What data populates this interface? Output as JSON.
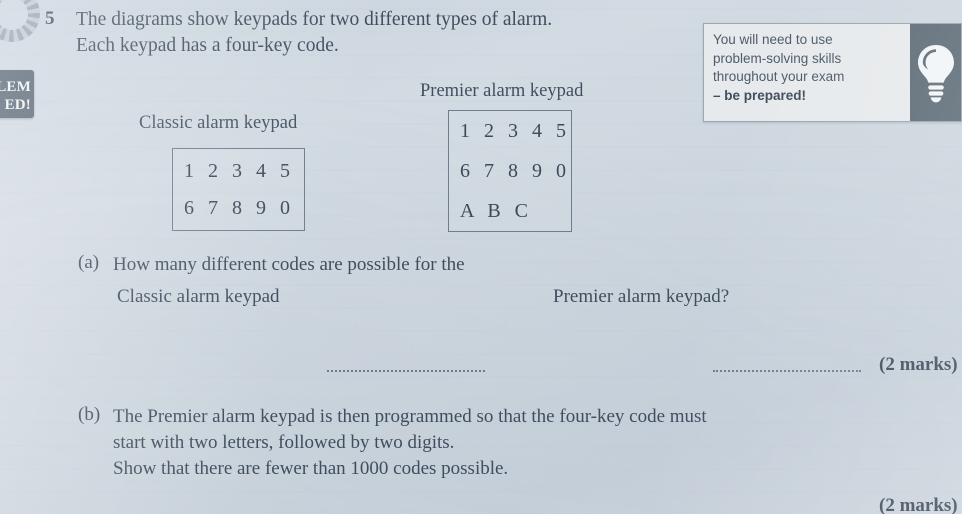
{
  "branding": {
    "logo_icon": "segmented-circle-logo",
    "badge": {
      "line1": "LEM",
      "line2": "ED!"
    }
  },
  "tip_box": {
    "line1": "You will need to use",
    "line2": "problem-solving skills",
    "line3": "throughout your exam",
    "line4": "– be prepared!",
    "icon": "lightbulb-icon",
    "background": "#e7eaec",
    "icon_panel_color": "#5f6d78"
  },
  "question": {
    "number": "5",
    "stem_line1": "The diagrams show keypads for two different types of alarm.",
    "stem_line2": "Each keypad has a four-key code."
  },
  "keypads": {
    "classic": {
      "caption": "Classic alarm keypad",
      "rows": [
        "1 2 3 4 5",
        "6 7 8 9 0"
      ]
    },
    "premier": {
      "caption": "Premier alarm keypad",
      "rows": [
        "1 2 3 4 5",
        "6 7 8 9 0",
        "A B C"
      ]
    }
  },
  "parts": {
    "a": {
      "label": "(a)",
      "text": "How many different codes are possible for the",
      "sub_left": "Classic alarm keypad",
      "sub_right": "Premier alarm keypad?",
      "marks": "(2 marks)"
    },
    "b": {
      "label": "(b)",
      "line1": "The Premier alarm keypad is then programmed so that the four-key code must",
      "line2": "start with two letters, followed by two digits.",
      "line3": "Show that there are fewer than 1000 codes possible.",
      "marks": "(2 marks)"
    }
  },
  "colors": {
    "paper": "#ccd5de",
    "ink": "#3f4d5e",
    "rule": "#6f7d8c"
  }
}
